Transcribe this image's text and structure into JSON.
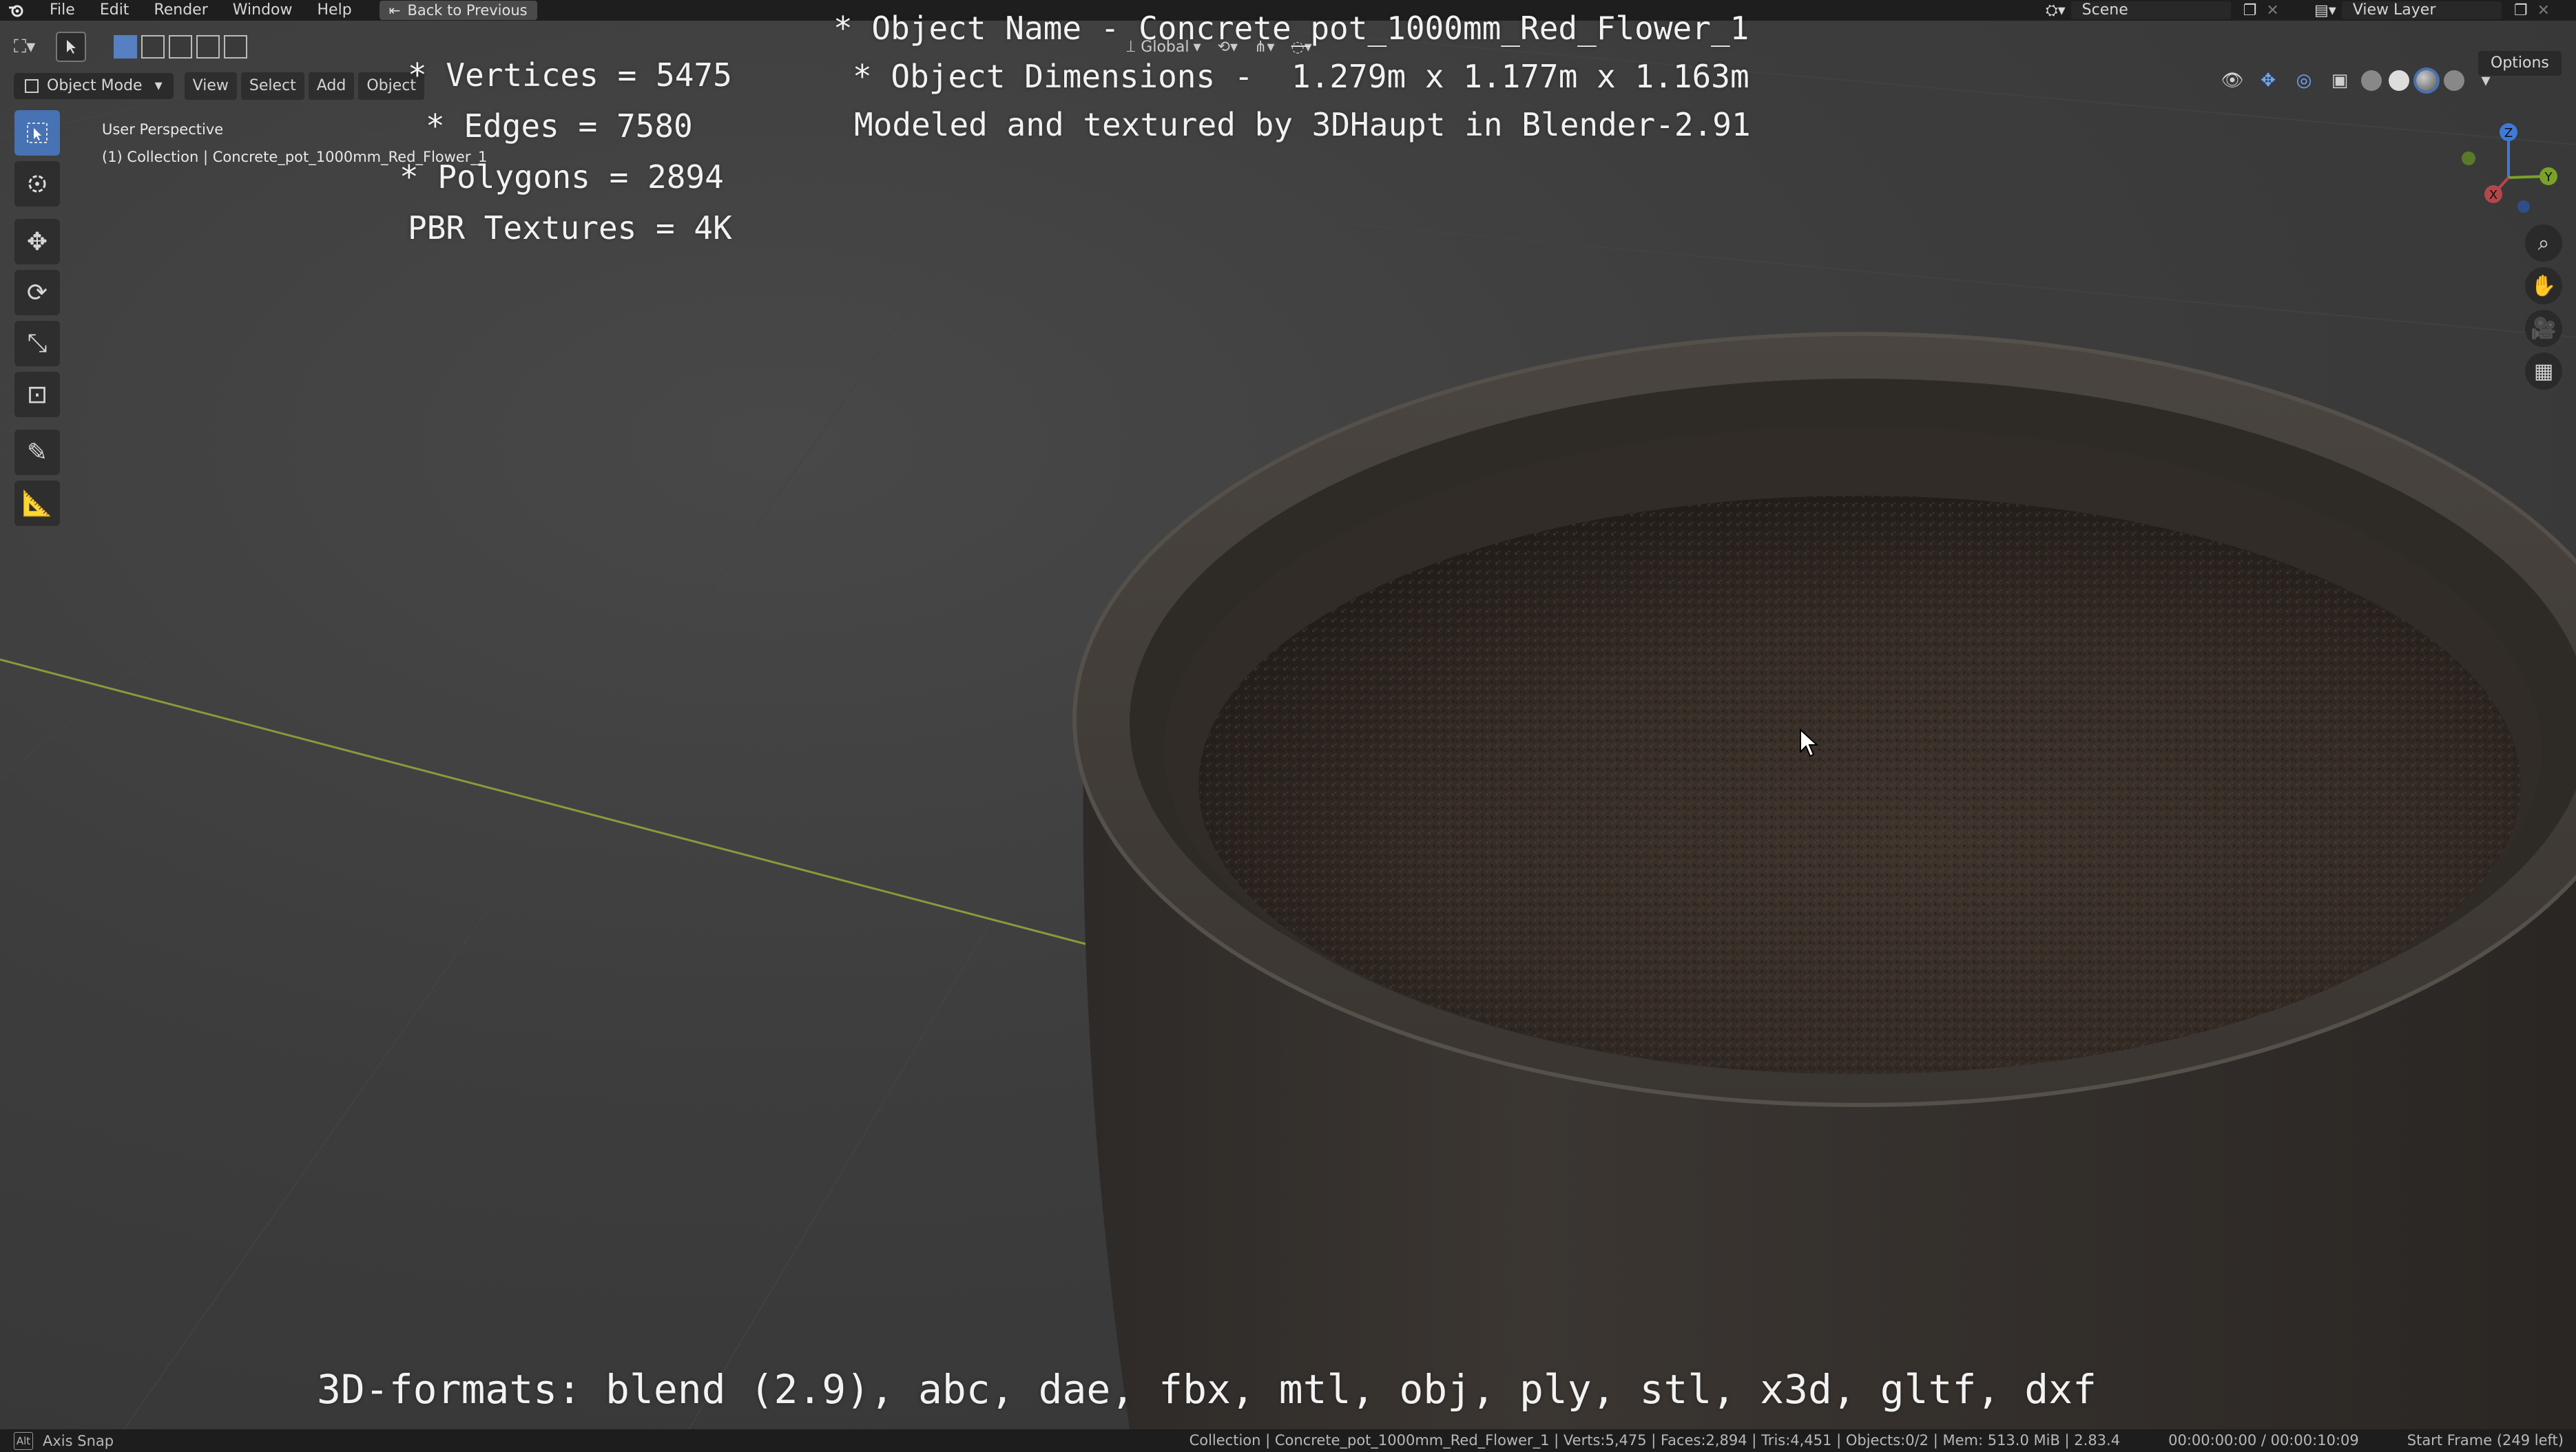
{
  "topbar": {
    "menus": [
      "File",
      "Edit",
      "Render",
      "Window",
      "Help"
    ],
    "back_button": "Back to Previous",
    "scene_label": "Scene",
    "view_layer_label": "View Layer"
  },
  "viewport_header": {
    "mode": "Object Mode",
    "menus": [
      "View",
      "Select",
      "Add",
      "Object"
    ],
    "transform_orientation": "Global",
    "options": "Options"
  },
  "viewport_info": {
    "perspective": "User Perspective",
    "collection": "(1) Collection | Concrete_pot_1000mm_Red_Flower_1"
  },
  "overlay": {
    "object_name": "* Object Name - Concrete_pot_1000mm_Red_Flower_1",
    "dimensions": "* Object Dimensions -  1.279m x 1.177m x 1.163m",
    "modeled_by": "Modeled and textured by 3DHaupt in Blender-2.91",
    "vertices": "* Vertices = 5475",
    "edges": "* Edges = 7580",
    "polygons": "* Polygons = 2894",
    "pbr": "PBR Textures = 4K",
    "formats": "3D-formats: blend (2.9), abc, dae, fbx, mtl, obj, ply, stl, x3d, gltf, dxf"
  },
  "gizmo": {
    "x": "X",
    "y": "Y",
    "z": "Z"
  },
  "statusbar": {
    "key": "Alt",
    "hint": "Axis Snap",
    "stats": "Collection | Concrete_pot_1000mm_Red_Flower_1 | Verts:5,475 | Faces:2,894 | Tris:4,451 | Objects:0/2 | Mem: 513.0 MiB | 2.83.4",
    "time": "00:00:00:00 / 00:00:10:09",
    "frame": "Start Frame (249 left)"
  },
  "colors": {
    "axis_x": "#b5464a",
    "axis_y": "#7aa12a",
    "axis_z": "#3f7ad8",
    "accent": "#4772b3"
  }
}
